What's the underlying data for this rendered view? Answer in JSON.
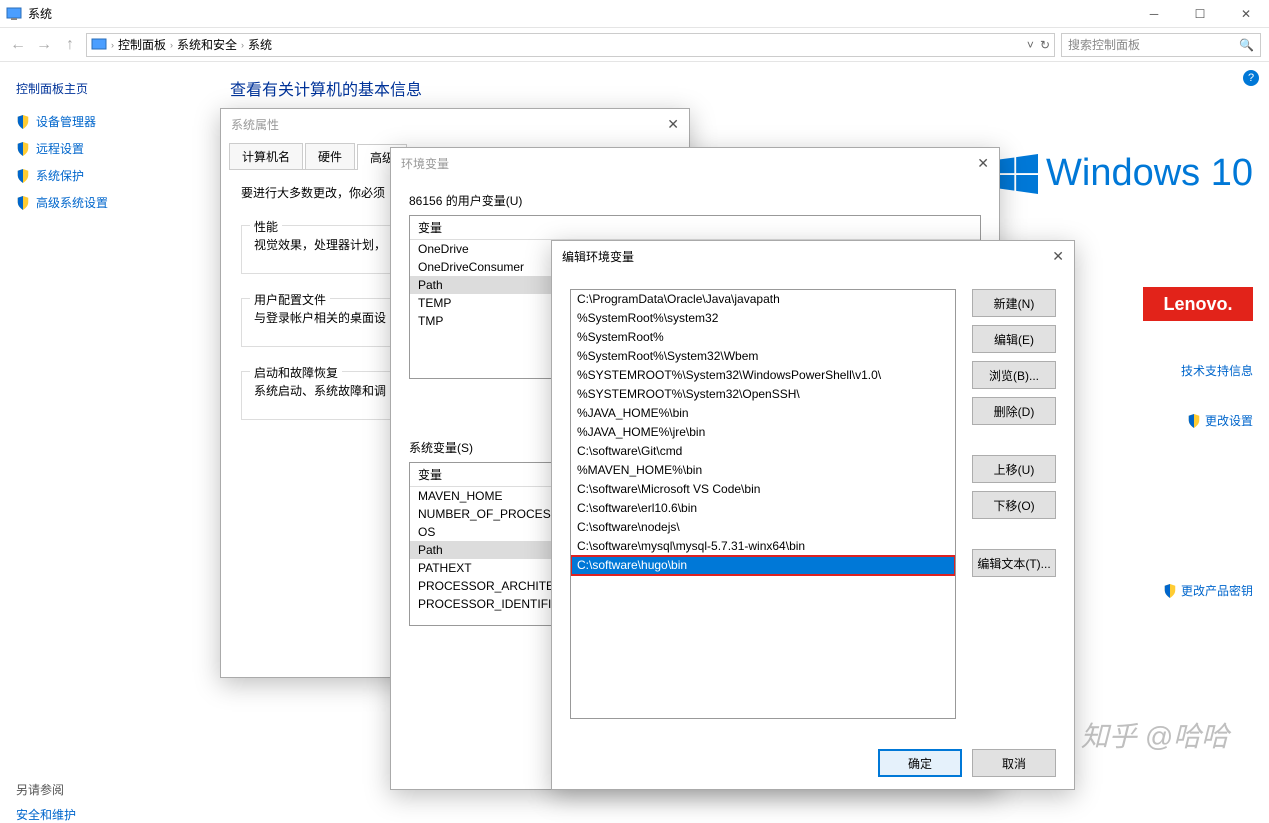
{
  "window": {
    "title": "系统"
  },
  "breadcrumb": {
    "items": [
      "控制面板",
      "系统和安全",
      "系统"
    ]
  },
  "search": {
    "placeholder": "搜索控制面板"
  },
  "leftPane": {
    "home": "控制面板主页",
    "links": [
      "设备管理器",
      "远程设置",
      "系统保护",
      "高级系统设置"
    ],
    "seeAlso": "另请参阅",
    "seeAlsoLink": "安全和维护"
  },
  "main": {
    "heading": "查看有关计算机的基本信息"
  },
  "branding": {
    "windows": "Windows 10",
    "lenovo": "Lenovo."
  },
  "rightLinks": {
    "support": "技术支持信息",
    "changeSettings": "更改设置",
    "changeKey": "更改产品密钥"
  },
  "sysprop": {
    "title": "系统属性",
    "tabs": [
      "计算机名",
      "硬件",
      "高级"
    ],
    "activeTab": 2,
    "instruction": "要进行大多数更改，你必须",
    "groups": {
      "perf": {
        "legend": "性能",
        "desc": "视觉效果，处理器计划，"
      },
      "profile": {
        "legend": "用户配置文件",
        "desc": "与登录帐户相关的桌面设"
      },
      "startup": {
        "legend": "启动和故障恢复",
        "desc": "系统启动、系统故障和调"
      }
    }
  },
  "env": {
    "title": "环境变量",
    "userSection": "86156 的用户变量(U)",
    "userHeader": "变量",
    "userVars": [
      "OneDrive",
      "OneDriveConsumer",
      "Path",
      "TEMP",
      "TMP"
    ],
    "userSelected": "Path",
    "sysSection": "系统变量(S)",
    "sysHeader": "变量",
    "sysVars": [
      "MAVEN_HOME",
      "NUMBER_OF_PROCESS",
      "OS",
      "Path",
      "PATHEXT",
      "PROCESSOR_ARCHITE",
      "PROCESSOR_IDENTIFI"
    ],
    "sysSelected": "Path"
  },
  "edit": {
    "title": "编辑环境变量",
    "paths": [
      "C:\\ProgramData\\Oracle\\Java\\javapath",
      "%SystemRoot%\\system32",
      "%SystemRoot%",
      "%SystemRoot%\\System32\\Wbem",
      "%SYSTEMROOT%\\System32\\WindowsPowerShell\\v1.0\\",
      "%SYSTEMROOT%\\System32\\OpenSSH\\",
      "%JAVA_HOME%\\bin",
      "%JAVA_HOME%\\jre\\bin",
      "C:\\software\\Git\\cmd",
      "%MAVEN_HOME%\\bin",
      "C:\\software\\Microsoft VS Code\\bin",
      "C:\\software\\erl10.6\\bin",
      "C:\\software\\nodejs\\",
      "C:\\software\\mysql\\mysql-5.7.31-winx64\\bin",
      "C:\\software\\hugo\\bin"
    ],
    "selectedIndex": 14,
    "buttons": {
      "new": "新建(N)",
      "edit": "编辑(E)",
      "browse": "浏览(B)...",
      "delete": "删除(D)",
      "up": "上移(U)",
      "down": "下移(O)",
      "editText": "编辑文本(T)...",
      "ok": "确定",
      "cancel": "取消"
    }
  },
  "watermark": "知乎 @哈哈"
}
